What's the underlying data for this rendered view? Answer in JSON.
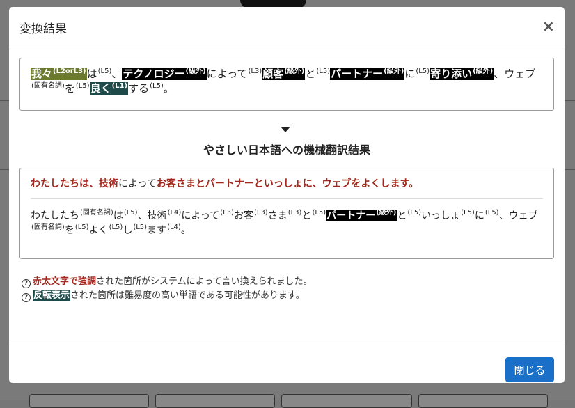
{
  "modal": {
    "title": "変換結果",
    "close_icon": "×",
    "footer_button": "閉じる"
  },
  "original": {
    "tokens": [
      {
        "text": "我々",
        "sup": "(L2orL3)",
        "hl": "olive"
      },
      {
        "text": "は",
        "sup": "(L5)",
        "hl": ""
      },
      {
        "text": "、",
        "sup": "",
        "hl": ""
      },
      {
        "text": "テクノロジー",
        "sup": "(級外)",
        "hl": "black"
      },
      {
        "text": "によって",
        "sup": "(L3)",
        "hl": ""
      },
      {
        "text": "顧客",
        "sup": "(級外)",
        "hl": "black"
      },
      {
        "text": "と",
        "sup": "(L5)",
        "hl": ""
      },
      {
        "text": "パートナー",
        "sup": "(級外)",
        "hl": "black"
      },
      {
        "text": "に",
        "sup": "(L5)",
        "hl": ""
      },
      {
        "text": "寄り添い",
        "sup": "(級外)",
        "hl": "black"
      },
      {
        "text": "、ウェブ",
        "sup": "(固有名詞)",
        "hl": ""
      },
      {
        "text": "を",
        "sup": "(L5)",
        "hl": ""
      },
      {
        "text": "良く",
        "sup": "(L1)",
        "hl": "teal"
      },
      {
        "text": "する",
        "sup": "(L5)",
        "hl": ""
      },
      {
        "text": "。",
        "sup": "",
        "hl": ""
      }
    ]
  },
  "result_heading": "やさしい日本語への機械翻訳結果",
  "easy": {
    "sentence": [
      {
        "text": "わたしたちは、技術",
        "red": true
      },
      {
        "text": "によって",
        "red": false
      },
      {
        "text": "お客さまとパートナーといっしょに、ウェブをよくします。",
        "red": true
      }
    ],
    "tokens": [
      {
        "text": "わたしたち",
        "sup": "(固有名詞)",
        "hl": ""
      },
      {
        "text": "は",
        "sup": "(L5)",
        "hl": ""
      },
      {
        "text": "、技術",
        "sup": "(L4)",
        "hl": ""
      },
      {
        "text": "によって",
        "sup": "(L3)",
        "hl": ""
      },
      {
        "text": "お客",
        "sup": "(L3)",
        "hl": ""
      },
      {
        "text": "さま",
        "sup": "(L3)",
        "hl": ""
      },
      {
        "text": "と",
        "sup": "(L5)",
        "hl": ""
      },
      {
        "text": "パートナー",
        "sup": "(級外)",
        "hl": "black"
      },
      {
        "text": "と",
        "sup": "(L5)",
        "hl": ""
      },
      {
        "text": "いっしょ",
        "sup": "(L5)",
        "hl": ""
      },
      {
        "text": "に",
        "sup": "(L5)",
        "hl": ""
      },
      {
        "text": "、ウェブ",
        "sup": "(固有名詞)",
        "hl": ""
      },
      {
        "text": "を",
        "sup": "(L5)",
        "hl": ""
      },
      {
        "text": "よく",
        "sup": "(L5)",
        "hl": ""
      },
      {
        "text": "し",
        "sup": "(L5)",
        "hl": ""
      },
      {
        "text": "ます",
        "sup": "(L4)",
        "hl": ""
      },
      {
        "text": "。",
        "sup": "",
        "hl": ""
      }
    ]
  },
  "help": {
    "line1_mark": "赤太文字で強調",
    "line1_rest": "された箇所がシステムによって言い換えられました。",
    "line2_mark": "反転表示",
    "line2_rest": "された箇所は難易度の高い単語である可能性があります。",
    "icon": "?"
  }
}
